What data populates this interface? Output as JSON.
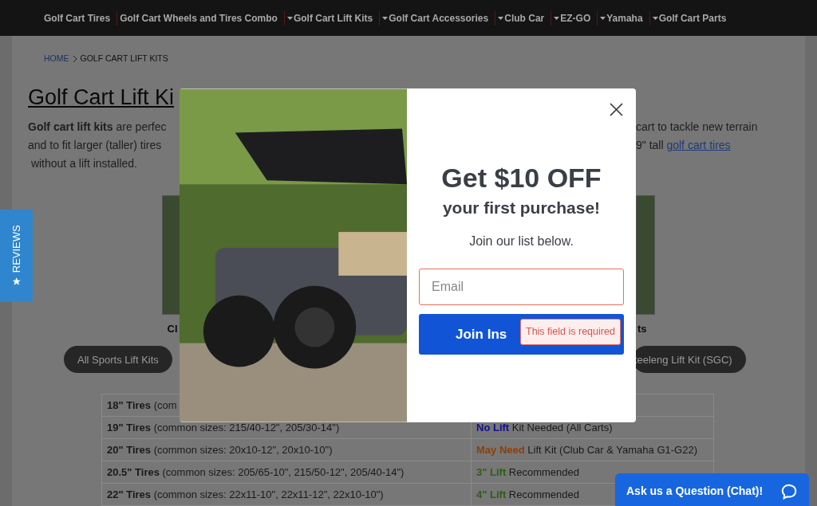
{
  "nav": [
    {
      "label": "Golf Cart Tires",
      "dropdown": false
    },
    {
      "label": "Golf Cart Wheels and Tires Combo",
      "dropdown": false
    },
    {
      "label": "Golf Cart Lift Kits",
      "dropdown": true
    },
    {
      "label": "Golf Cart Accessories",
      "dropdown": true
    },
    {
      "label": "Club Car",
      "dropdown": true
    },
    {
      "label": "EZ-GO",
      "dropdown": true
    },
    {
      "label": "Yamaha",
      "dropdown": true
    },
    {
      "label": "Golf Cart Parts",
      "dropdown": true
    }
  ],
  "breadcrumb": {
    "home": "HOME",
    "current": "GOLF CART LIFT KITS"
  },
  "title": "Golf Cart Lift Ki",
  "intro": {
    "left": [
      "**Golf cart lift kits** are perfec",
      "and to fit larger (taller) tires",
      " without a lift installed."
    ],
    "right": [
      "cart to tackle new terrain",
      "9\" tall "
    ],
    "link": "golf cart tires"
  },
  "cards": [
    {
      "caption": "Cl"
    },
    {
      "caption": "ts"
    }
  ],
  "pills": [
    "All Sports Lift Kits",
    "teeleng Lift Kit (SGC)"
  ],
  "table": {
    "rows": [
      {
        "size": "**18\" Tires** (com"
      },
      {
        "size": "**19\" Tires** (common sizes: 215/40-12\", 205/30-14\")",
        "highlight": "No Lift",
        "rest": " Kit Needed (All Carts)",
        "color": "#12128c"
      },
      {
        "size": "**20\" Tires** (common sizes: 20x10-12\", 20x10-10\")",
        "highlight": "May Need",
        "rest": " Lift Kit (Club Car & Yamaha G1-G22)",
        "color": "#8a400e"
      },
      {
        "size": "**20.5\" Tires** (common sizes: 205/65-10\", 215/50-12\", 205/40-14\")",
        "highlight": "3\" Lift",
        "rest": " Recommended",
        "color": "#2f5e14"
      },
      {
        "size": "**22\" Tires** (common sizes: 22x11-10\", 22x11-12\", 22x10-10\")",
        "highlight": "4\" Lift",
        "rest": " Recommended",
        "color": "#2f5e14"
      }
    ]
  },
  "reviews_tab": "REVIEWS",
  "popup": {
    "headline": "Get $10 OFF",
    "subhead": "your first purchase!",
    "note": "Join our list below.",
    "email": {
      "placeholder": "Email",
      "invalid": true
    },
    "button": "Join Ins",
    "error": "This field is required"
  },
  "chat": "Ask us a Question (Chat)!"
}
